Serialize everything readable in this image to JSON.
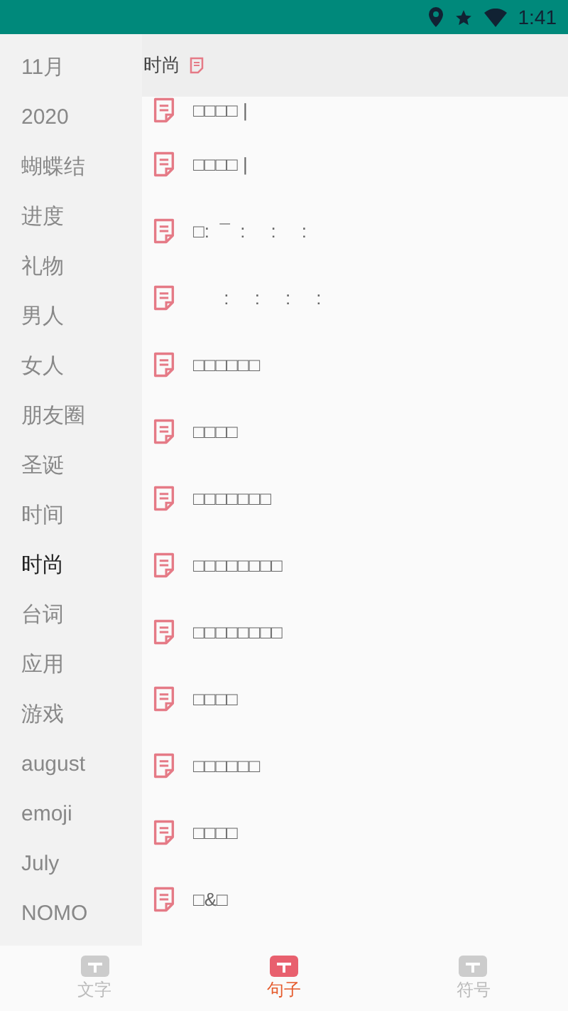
{
  "status_bar": {
    "time": "1:41"
  },
  "sidebar": {
    "items": [
      {
        "label": "11月",
        "selected": false
      },
      {
        "label": "2020",
        "selected": false
      },
      {
        "label": "蝴蝶结",
        "selected": false
      },
      {
        "label": "进度",
        "selected": false
      },
      {
        "label": "礼物",
        "selected": false
      },
      {
        "label": "男人",
        "selected": false
      },
      {
        "label": "女人",
        "selected": false
      },
      {
        "label": "朋友圈",
        "selected": false
      },
      {
        "label": "圣诞",
        "selected": false
      },
      {
        "label": "时间",
        "selected": false
      },
      {
        "label": "时尚",
        "selected": true
      },
      {
        "label": "台词",
        "selected": false
      },
      {
        "label": "应用",
        "selected": false
      },
      {
        "label": "游戏",
        "selected": false
      },
      {
        "label": "august",
        "selected": false
      },
      {
        "label": "emoji",
        "selected": false
      },
      {
        "label": "July",
        "selected": false
      },
      {
        "label": "NOMO",
        "selected": false
      }
    ]
  },
  "header": {
    "title": "时尚"
  },
  "list": [
    {
      "text": "□□□□ |"
    },
    {
      "text": "□□□□ |"
    },
    {
      "text": "□:  ¯  :     :     :"
    },
    {
      "text": "      :     :     :     :"
    },
    {
      "text": "□□□□□□"
    },
    {
      "text": "□□□□"
    },
    {
      "text": "□□□□□□□"
    },
    {
      "text": "□□□□□□□□"
    },
    {
      "text": "□□□□□□□□"
    },
    {
      "text": "□□□□"
    },
    {
      "text": "□□□□□□"
    },
    {
      "text": "□□□□"
    },
    {
      "text": "□&□"
    }
  ],
  "bottom_nav": [
    {
      "label": "文字",
      "selected": false
    },
    {
      "label": "句子",
      "selected": true
    },
    {
      "label": "符号",
      "selected": false
    }
  ]
}
